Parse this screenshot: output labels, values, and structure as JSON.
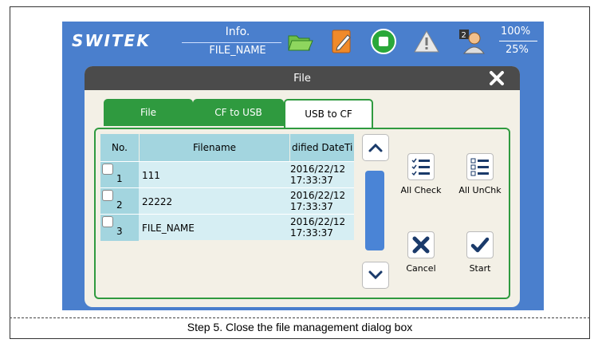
{
  "brand": {
    "logo": "SWITEK"
  },
  "topbar": {
    "info_label": "Info.",
    "file_name": "FILE_NAME",
    "percent_top": "100%",
    "percent_bottom": "25%"
  },
  "dialog": {
    "title": "File",
    "tabs": [
      {
        "label": "File"
      },
      {
        "label": "CF to USB"
      },
      {
        "label": "USB to CF",
        "active": true
      }
    ],
    "table": {
      "headers": [
        "No.",
        "Filename",
        "dified DateTi"
      ],
      "rows": [
        {
          "no": "1",
          "filename": "111",
          "date": "2016/22/12",
          "time": "17:33:37"
        },
        {
          "no": "2",
          "filename": "22222",
          "date": "2016/22/12",
          "time": "17:33:37"
        },
        {
          "no": "3",
          "filename": "FILE_NAME",
          "date": "2016/22/12",
          "time": "17:33:37"
        }
      ]
    },
    "actions": {
      "all_check": "All Check",
      "all_uncheck": "All UnChk",
      "cancel": "Cancel",
      "start": "Start"
    }
  },
  "caption": "Step 5. Close the file management dialog box",
  "colors": {
    "screen": "#4a7fcd",
    "tab_green": "#2f9a3f",
    "header_cell": "#a3d5df",
    "row_cell": "#d6eef3"
  }
}
